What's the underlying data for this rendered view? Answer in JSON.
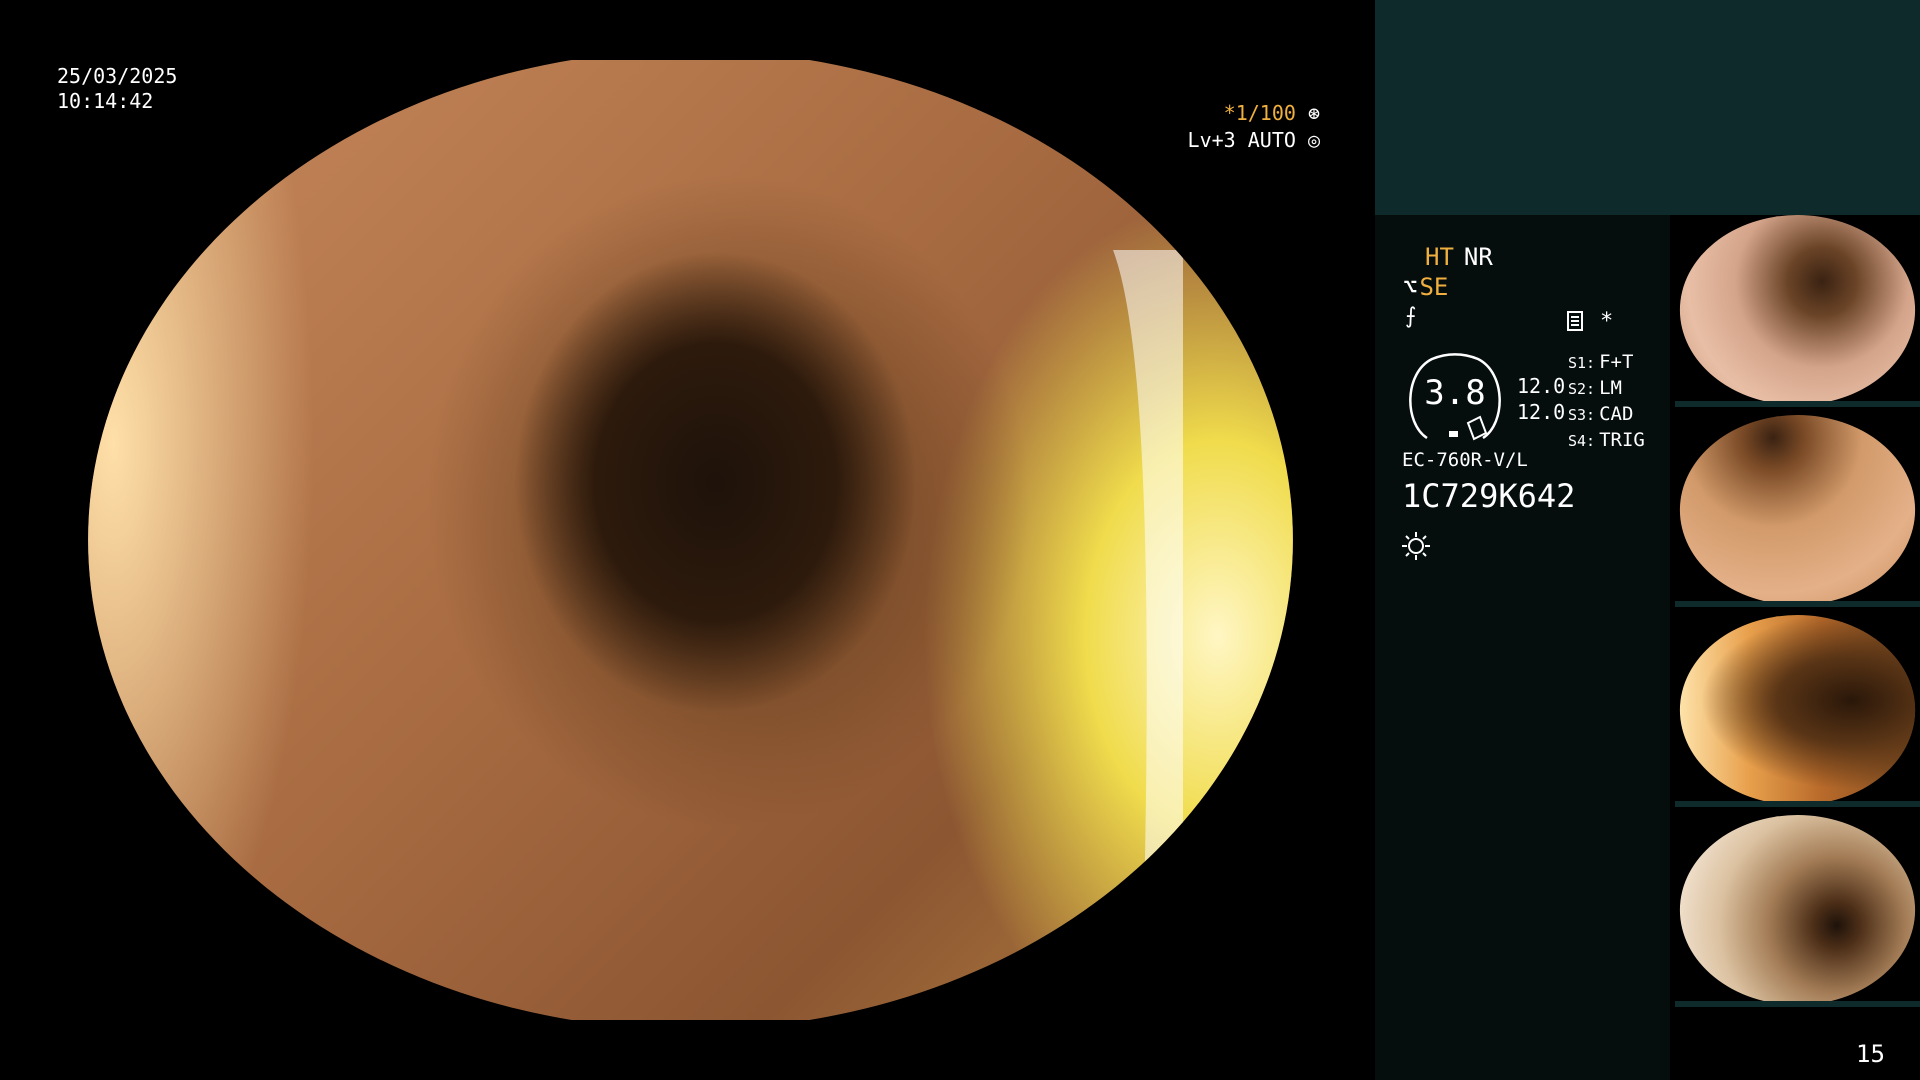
{
  "overlay": {
    "date": "25/03/2025",
    "time": "10:14:42",
    "shutter": "*1/100",
    "shutter_icon": "aperture-icon",
    "level": "Lv+3 AUTO",
    "level_icon": "iris-icon"
  },
  "info": {
    "mode_ht": "HT",
    "mode_nr": "NR",
    "se_symbol": "⌥",
    "mode_se": "SE",
    "sym_line": "⨍",
    "star": "*",
    "zoom_value": "3.8",
    "values": [
      "12.0",
      "12.0"
    ],
    "settings": [
      {
        "key": "S1:",
        "value": "F+T"
      },
      {
        "key": "S2:",
        "value": "LM"
      },
      {
        "key": "S3:",
        "value": "CAD"
      },
      {
        "key": "S4:",
        "value": "TRIG"
      }
    ],
    "scope_model": "EC-760R-V/L",
    "serial": "1C729K642"
  },
  "thumbnails": [
    {
      "name": "thumbnail-1"
    },
    {
      "name": "thumbnail-2"
    },
    {
      "name": "thumbnail-3"
    },
    {
      "name": "thumbnail-4"
    }
  ],
  "page_number": "15"
}
